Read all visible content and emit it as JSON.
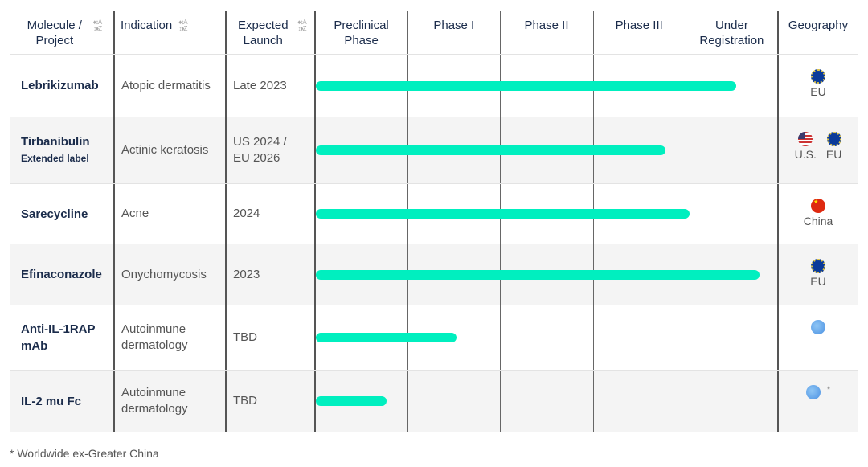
{
  "headers": {
    "molecule": "Molecule / Project",
    "indication": "Indication",
    "launch": "Expected Launch",
    "phases": [
      "Preclinical Phase",
      "Phase I",
      "Phase II",
      "Phase III",
      "Under Registration"
    ],
    "geography": "Geography",
    "sort_icon": "sort-az-icon"
  },
  "rows": [
    {
      "molecule": "Lebrikizumab",
      "sub": "",
      "indication": "Atopic dermatitis",
      "launch": "Late 2023",
      "progress_phases": 4.54,
      "geo": [
        {
          "flag": "eu",
          "label": "EU"
        }
      ]
    },
    {
      "molecule": "Tirbanibulin",
      "sub": "Extended label",
      "indication": "Actinic keratosis",
      "launch": "US 2024 / EU 2026",
      "progress_phases": 3.78,
      "geo": [
        {
          "flag": "us",
          "label": "U.S."
        },
        {
          "flag": "eu",
          "label": "EU"
        }
      ]
    },
    {
      "molecule": "Sarecycline",
      "sub": "",
      "indication": "Acne",
      "launch": "2024",
      "progress_phases": 4.04,
      "geo": [
        {
          "flag": "cn",
          "label": "China"
        }
      ]
    },
    {
      "molecule": "Efinaconazole",
      "sub": "",
      "indication": "Onychomycosis",
      "launch": "2023",
      "progress_phases": 4.79,
      "geo": [
        {
          "flag": "eu",
          "label": "EU"
        }
      ]
    },
    {
      "molecule": "Anti-IL-1RAP mAb",
      "sub": "",
      "indication": "Autoinmune dermatology",
      "launch": "TBD",
      "progress_phases": 1.52,
      "geo": [
        {
          "flag": "globe",
          "label": ""
        }
      ]
    },
    {
      "molecule": "IL-2 mu Fc",
      "sub": "",
      "indication": "Autoinmune dermatology",
      "launch": "TBD",
      "progress_phases": 0.76,
      "geo": [
        {
          "flag": "globe",
          "label": "*"
        }
      ]
    }
  ],
  "bar_color": "#00efbf",
  "footnote": "* Worldwide ex-Greater China"
}
